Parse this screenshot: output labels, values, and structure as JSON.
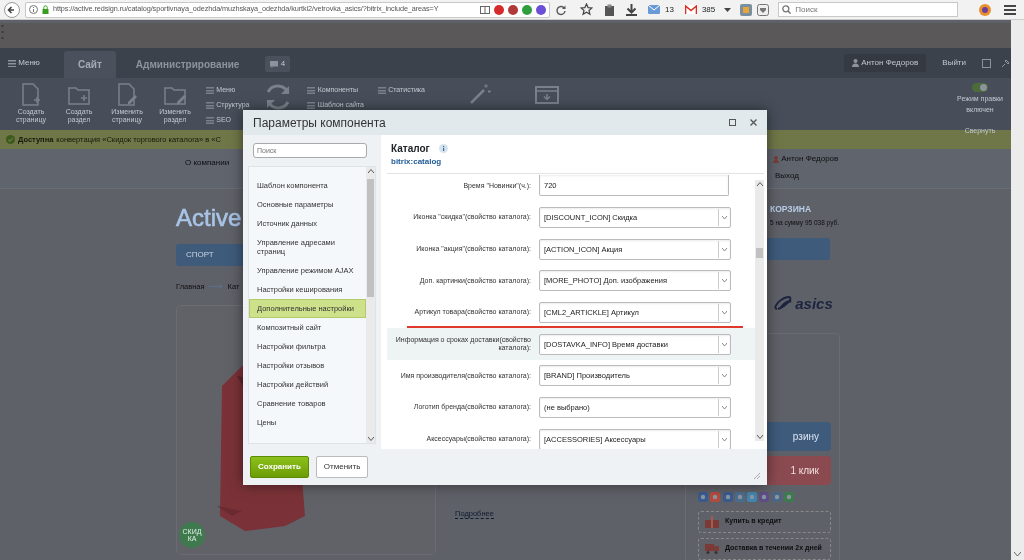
{
  "browser": {
    "url": "https://active.redsign.ru/catalog/sportivnaya_odezhda/muzhskaya_odezhda/kurtki2/vetrovka_asics/?bitrix_include_areas=Y",
    "mail_count": "13",
    "gmail_count": "385",
    "search_placeholder": "Поиск"
  },
  "admin_panel": {
    "menu": "Меню",
    "tabs": [
      {
        "label": "Сайт",
        "selected": true
      },
      {
        "label": "Администрирование",
        "selected": false
      }
    ],
    "notifications": "4",
    "user": "Антон Федоров",
    "logout": "Выйти",
    "big_tools": [
      {
        "label": "Создать страницу",
        "kind": "new-page"
      },
      {
        "label": "Создать раздел",
        "kind": "new-folder"
      },
      {
        "label": "Изменить страницу",
        "kind": "edit-page"
      },
      {
        "label": "Изменить раздел",
        "kind": "edit-folder"
      }
    ],
    "small_tools": [
      "Меню",
      "Структура",
      "SEO"
    ],
    "small_tools_2": [
      "Компоненты",
      "Шаблон сайта"
    ],
    "small_tools_3": [
      "Статистика"
    ],
    "edit_mode": {
      "label": "Режим правки включен",
      "on": true
    },
    "collapse": "Свернуть"
  },
  "notice": {
    "title": "Доступна",
    "text": "конвертация «Скидок торгового каталога» в «С"
  },
  "site": {
    "top_link": "О компании",
    "user": "Антон Федоров",
    "logout": "Выход",
    "logo": "Active",
    "nav": [
      "СПОРТ"
    ],
    "breadcrumb": [
      "Главная",
      "Кат"
    ],
    "discount_badge": "СКИДКА",
    "more_link": "Подробнее",
    "cart_title": "КОРЗИНА",
    "cart_summary": "5 на сумму 95 038 руб.",
    "brand": "asics",
    "buy_button": "рзину",
    "one_click_button": "1 клик",
    "credit": "Купить в кредит",
    "delivery": "Доставка в течении 2х дней"
  },
  "dialog": {
    "title": "Параметры компонента",
    "search_placeholder": "Поиск",
    "sections": [
      {
        "label": "Шаблон компонента",
        "selected": false
      },
      {
        "label": "Основные параметры",
        "selected": false
      },
      {
        "label": "Источник данных",
        "selected": false
      },
      {
        "label": "Управление адресами страниц",
        "selected": false
      },
      {
        "label": "Управление режимом AJAX",
        "selected": false
      },
      {
        "label": "Настройки кеширования",
        "selected": false
      },
      {
        "label": "Дополнительные настройки",
        "selected": true
      },
      {
        "label": "Композитный сайт",
        "selected": false
      },
      {
        "label": "Настройки фильтра",
        "selected": false
      },
      {
        "label": "Настройки отзывов",
        "selected": false
      },
      {
        "label": "Настройки действий",
        "selected": false
      },
      {
        "label": "Сравнение товаров",
        "selected": false
      },
      {
        "label": "Цены",
        "selected": false
      }
    ],
    "component_title": "Каталог",
    "component_code": "bitrix:catalog",
    "fields": [
      {
        "label": "Время \"Новинки\"(ч.):",
        "kind": "input",
        "value": "720",
        "highlighted": false,
        "underlined": false
      },
      {
        "label": "Иконка \"скидка\"(свойство каталога):",
        "kind": "select",
        "value": "[DISCOUNT_ICON] Скидка",
        "highlighted": false,
        "underlined": false
      },
      {
        "label": "Иконка \"акция\"(свойство каталога):",
        "kind": "select",
        "value": "[ACTION_ICON] Акция",
        "highlighted": false,
        "underlined": false
      },
      {
        "label": "Доп. картинки(свойство каталога):",
        "kind": "select",
        "value": "[MORE_PHOTO] Доп. изображения",
        "highlighted": false,
        "underlined": false
      },
      {
        "label": "Артикул товара(свойство каталога):",
        "kind": "select",
        "value": "[CML2_ARTICKLE] Артикул",
        "highlighted": false,
        "underlined": true
      },
      {
        "label": "Информация о сроках доставки(свойство каталога):",
        "kind": "select",
        "value": "[DOSTAVKA_INFO] Время доставки",
        "highlighted": true,
        "underlined": false
      },
      {
        "label": "Имя производителя(свойство каталога):",
        "kind": "select",
        "value": "[BRAND] Производитель",
        "highlighted": false,
        "underlined": false
      },
      {
        "label": "Логотип бренда(свойство каталога):",
        "kind": "select",
        "value": "(не выбрано)",
        "highlighted": false,
        "underlined": false
      },
      {
        "label": "Аксессуары(свойство каталога):",
        "kind": "select",
        "value": "[ACCESSORIES] Аксессуары",
        "highlighted": false,
        "underlined": false
      }
    ],
    "buttons": [
      {
        "label": "Сохранить",
        "kind": "primary"
      },
      {
        "label": "Отменить",
        "kind": "secondary"
      }
    ]
  }
}
